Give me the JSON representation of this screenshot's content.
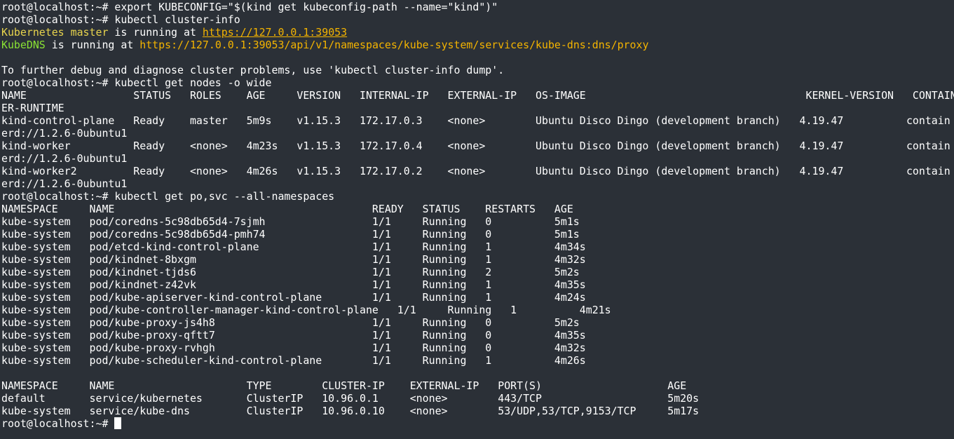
{
  "colors": {
    "background": "#2b3037",
    "foreground": "#ffffff",
    "master_label": "#e8d44d",
    "dns_label": "#8ae234",
    "url": "#f4b400"
  },
  "terminal": {
    "lines": [
      "root@localhost:~# export KUBECONFIG=\"$(kind get kubeconfig-path --name=\"kind\")\"",
      "root@localhost:~# kubectl cluster-info",
      "is running at ",
      "is running at ",
      "",
      "To further debug and diagnose cluster problems, use 'kubectl cluster-info dump'.",
      "root@localhost:~# kubectl get nodes -o wide",
      "NAME                 STATUS   ROLES    AGE     VERSION   INTERNAL-IP   EXTERNAL-IP   OS-IMAGE                                   KERNEL-VERSION   CONTAIN",
      "ER-RUNTIME",
      "kind-control-plane   Ready    master   5m9s    v1.15.3   172.17.0.3    <none>        Ubuntu Disco Dingo (development branch)   4.19.47          contain",
      "erd://1.2.6-0ubuntu1",
      "kind-worker          Ready    <none>   4m23s   v1.15.3   172.17.0.4    <none>        Ubuntu Disco Dingo (development branch)   4.19.47          contain",
      "erd://1.2.6-0ubuntu1",
      "kind-worker2         Ready    <none>   4m26s   v1.15.3   172.17.0.2    <none>        Ubuntu Disco Dingo (development branch)   4.19.47          contain",
      "erd://1.2.6-0ubuntu1",
      "root@localhost:~# kubectl get po,svc --all-namespaces",
      "NAMESPACE     NAME                                         READY   STATUS    RESTARTS   AGE",
      "kube-system   pod/coredns-5c98db65d4-7sjmh                 1/1     Running   0          5m1s",
      "kube-system   pod/coredns-5c98db65d4-pmh74                 1/1     Running   0          5m1s",
      "kube-system   pod/etcd-kind-control-plane                  1/1     Running   1          4m34s",
      "kube-system   pod/kindnet-8bxgm                            1/1     Running   1          4m32s",
      "kube-system   pod/kindnet-tjds6                            1/1     Running   2          5m2s",
      "kube-system   pod/kindnet-z42vk                            1/1     Running   1          4m35s",
      "kube-system   pod/kube-apiserver-kind-control-plane        1/1     Running   1          4m24s",
      "kube-system   pod/kube-controller-manager-kind-control-plane   1/1     Running   1          4m21s",
      "kube-system   pod/kube-proxy-js4h8                         1/1     Running   0          5m2s",
      "kube-system   pod/kube-proxy-qftt7                         1/1     Running   0          4m35s",
      "kube-system   pod/kube-proxy-rvhgh                         1/1     Running   0          4m32s",
      "kube-system   pod/kube-scheduler-kind-control-plane        1/1     Running   1          4m26s",
      "",
      "NAMESPACE     NAME                     TYPE        CLUSTER-IP    EXTERNAL-IP   PORT(S)                    AGE",
      "default       service/kubernetes       ClusterIP   10.96.0.1     <none>        443/TCP                    5m20s",
      "kube-system   service/kube-dns         ClusterIP   10.96.0.10    <none>        53/UDP,53/TCP,9153/TCP     5m17s",
      "root@localhost:~# "
    ],
    "master_label": "Kubernetes master",
    "master_url": "https://127.0.0.1:39053",
    "dns_label": "KubeDNS",
    "dns_url": "https://127.0.0.1:39053/api/v1/namespaces/kube-system/services/kube-dns:dns/proxy"
  }
}
